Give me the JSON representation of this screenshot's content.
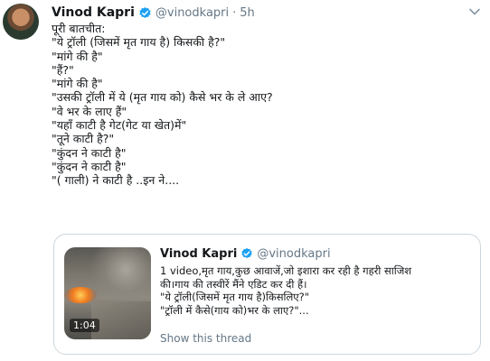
{
  "tweet": {
    "author_name": "Vinod Kapri",
    "handle": "@vinodkapri",
    "separator": "·",
    "time": "5h",
    "lines": [
      "पूरी बातचीत:",
      "\"ये ट्रॉली (जिसमें मृत गाय है) किसकी है?\"",
      "\"मांगे की है\"",
      "\"हैं?\"",
      "\"मांगे की है\"",
      "\"उसकी ट्रॉली में ये (मृत गाय को) कैसे भर के ले आए?",
      "\"वे भर के लाए हैं\"",
      "\"यहाँ काटी है गेट(गेट या खेत)में\"",
      "\"तूने काटी है?\"",
      "\"कुंदन ने काटी है\"",
      "\"कुंदन ने काटी है\"",
      "\"( गाली) ने काटी है ..इन ने...."
    ]
  },
  "quoted": {
    "author_name": "Vinod Kapri",
    "handle": "@vinodkapri",
    "video_duration": "1:04",
    "lines": [
      "1 video,मृत गाय,कुछ आवाजें,जो इशारा कर रही है गहरी साजिश",
      "की।गाय की तस्वीरें मैंने एडिट कर दी हैं।",
      "\"ये ट्रॉली(जिसमें मृत गाय है)किसलिए?\"",
      "\"ट्रॉली में कैसे(गाय को)भर के लाए?\"..."
    ],
    "show_thread": "Show this thread"
  },
  "colors": {
    "text": "#14171a",
    "secondary": "#657786",
    "verified": "#1da1f2",
    "border": "#ccd6dd"
  }
}
